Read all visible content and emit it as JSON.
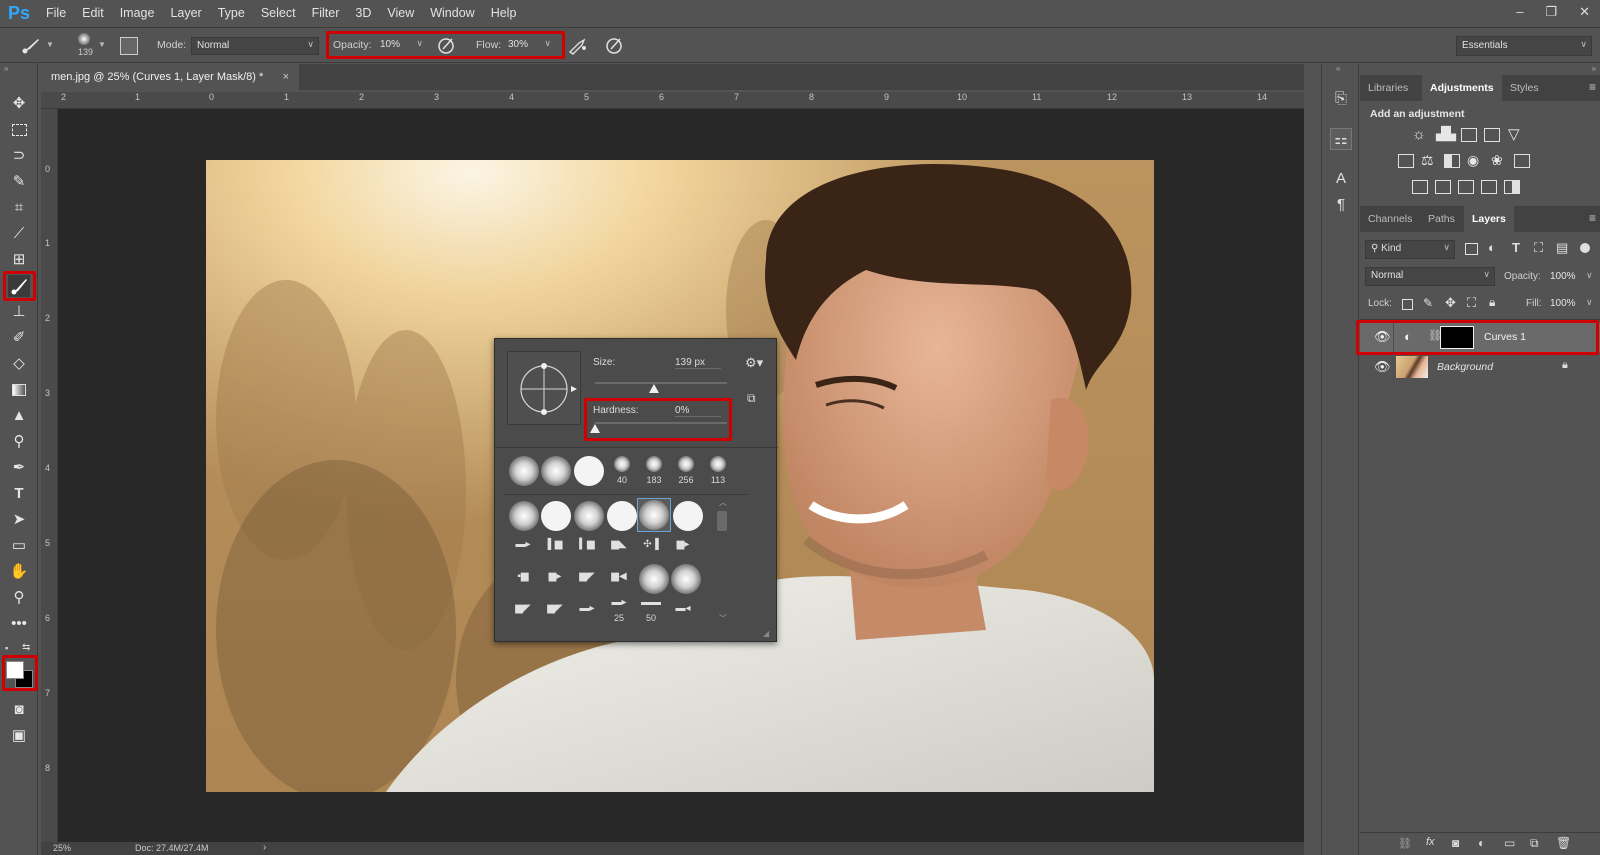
{
  "app": {
    "logo": "Ps"
  },
  "menu": [
    "File",
    "Edit",
    "Image",
    "Layer",
    "Type",
    "Select",
    "Filter",
    "3D",
    "View",
    "Window",
    "Help"
  ],
  "window_controls": {
    "minimize": "–",
    "restore": "❐",
    "close": "✕"
  },
  "options": {
    "brush_size": "139",
    "mode_label": "Mode:",
    "mode_value": "Normal",
    "opacity_label": "Opacity:",
    "opacity_value": "10%",
    "flow_label": "Flow:",
    "flow_value": "30%",
    "workspace": "Essentials"
  },
  "document": {
    "tab_title": "men.jpg @ 25% (Curves 1, Layer Mask/8) *",
    "tab_close": "×",
    "ruler_top": [
      "2",
      "1",
      "0",
      "1",
      "2",
      "3",
      "4",
      "5",
      "6",
      "7",
      "8",
      "9",
      "10",
      "11",
      "12",
      "13",
      "14"
    ],
    "ruler_left": [
      "0",
      "1",
      "2",
      "3",
      "4",
      "5",
      "6",
      "7",
      "8"
    ],
    "zoom": "25%",
    "doc_info": "Doc: 27.4M/27.4M",
    "status_arrow": "›"
  },
  "brush_popup": {
    "size_label": "Size:",
    "size_value": "139 px",
    "hardness_label": "Hardness:",
    "hardness_value": "0%",
    "size_fraction": 0.45,
    "hardness_fraction": 0.0,
    "preset_numbers_row1": [
      "40",
      "183",
      "256",
      "113"
    ],
    "preset_numbers_bottom": [
      "25",
      "50"
    ]
  },
  "panels": {
    "top_tabs": [
      "Libraries",
      "Adjustments",
      "Styles"
    ],
    "adjustments_title": "Add an adjustment",
    "layer_tabs": [
      "Channels",
      "Paths",
      "Layers"
    ],
    "filter_kind": "Kind",
    "blend_mode": "Normal",
    "opacity_label": "Opacity:",
    "opacity_value": "100%",
    "lock_label": "Lock:",
    "fill_label": "Fill:",
    "fill_value": "100%",
    "layers": [
      {
        "name": "Curves 1"
      },
      {
        "name": "Background"
      }
    ]
  },
  "colors": {
    "highlight": "#d00000",
    "panel": "#535353",
    "canvas": "#282828"
  }
}
